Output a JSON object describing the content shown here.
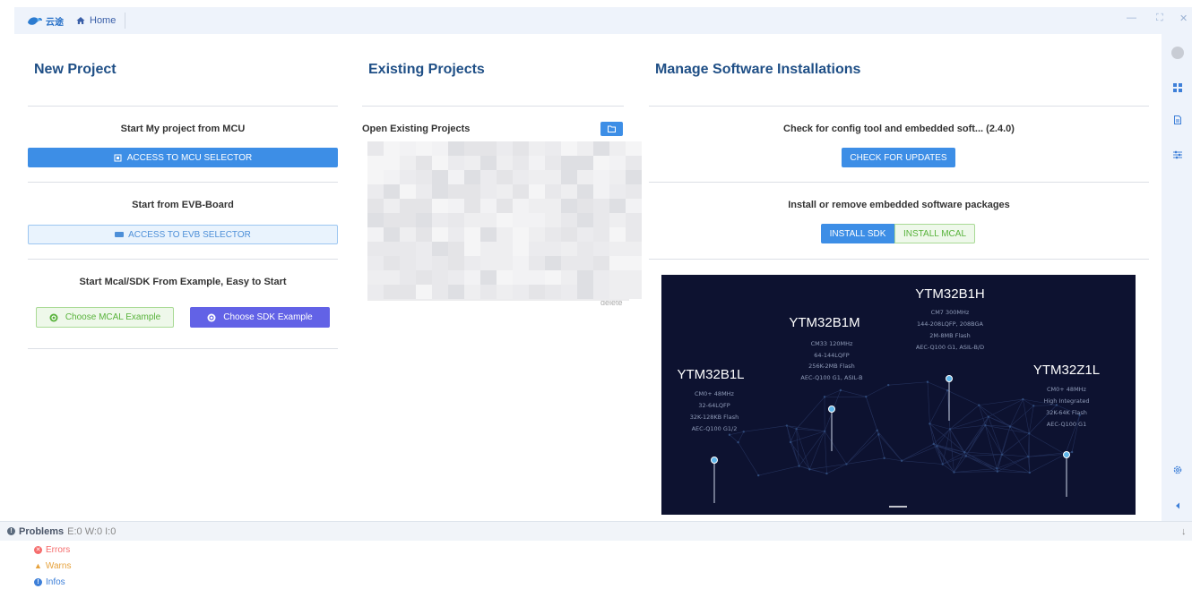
{
  "titlebar": {
    "logo_text": "云途",
    "home_label": "Home",
    "minimize": "—",
    "maximize": "⛶",
    "close": "✕"
  },
  "new_project": {
    "title": "New Project",
    "mcu_label": "Start My project from MCU",
    "mcu_button": "ACCESS TO MCU SELECTOR",
    "evb_label": "Start from EVB-Board",
    "evb_button": "ACCESS TO EVB SELECTOR",
    "example_label": "Start Mcal/SDK From Example, Easy to Start",
    "mcal_example_button": "Choose MCAL Example",
    "sdk_example_button": "Choose SDK Example"
  },
  "existing_projects": {
    "title": "Existing Projects",
    "open_label": "Open Existing Projects",
    "delete_label": "delete"
  },
  "manage_software": {
    "title": "Manage Software Installations",
    "check_label": "Check for config tool and embedded soft... (2.4.0)",
    "check_button": "CHECK FOR UPDATES",
    "install_label": "Install or remove embedded software packages",
    "install_sdk": "INSTALL SDK",
    "install_mcal": "INSTALL MCAL"
  },
  "banner": {
    "chips": [
      {
        "name": "YTM32B1L",
        "specs": [
          "CM0+ 48MHz",
          "32-64LQFP",
          "32K-128KB Flash",
          "AEC-Q100 G1/2"
        ]
      },
      {
        "name": "YTM32B1M",
        "specs": [
          "CM33 120MHz",
          "64-144LQFP",
          "256K-2MB Flash",
          "AEC-Q100 G1, ASIL-B"
        ]
      },
      {
        "name": "YTM32B1H",
        "specs": [
          "CM7 300MHz",
          "144-208LQFP, 208BGA",
          "2M-8MB Flash",
          "AEC-Q100 G1, ASIL-B/D"
        ]
      },
      {
        "name": "YTM32Z1L",
        "specs": [
          "CM0+ 48MHz",
          "High Integrated",
          "32K-64K Flash",
          "AEC-Q100 G1"
        ]
      }
    ]
  },
  "problems": {
    "title": "Problems",
    "counts": "E:0 W:0 I:0",
    "errors": "Errors",
    "warns": "Warns",
    "infos": "Infos",
    "info_glyph": "!",
    "error_glyph": "✕",
    "warn_glyph": "▲",
    "collapse_glyph": "↓"
  },
  "colors": {
    "accent": "#3d8ee6",
    "heading": "#1f4f86",
    "success": "#59b33c",
    "purple": "#6262e6",
    "error": "#f56c6c",
    "warning": "#e6a23c"
  }
}
